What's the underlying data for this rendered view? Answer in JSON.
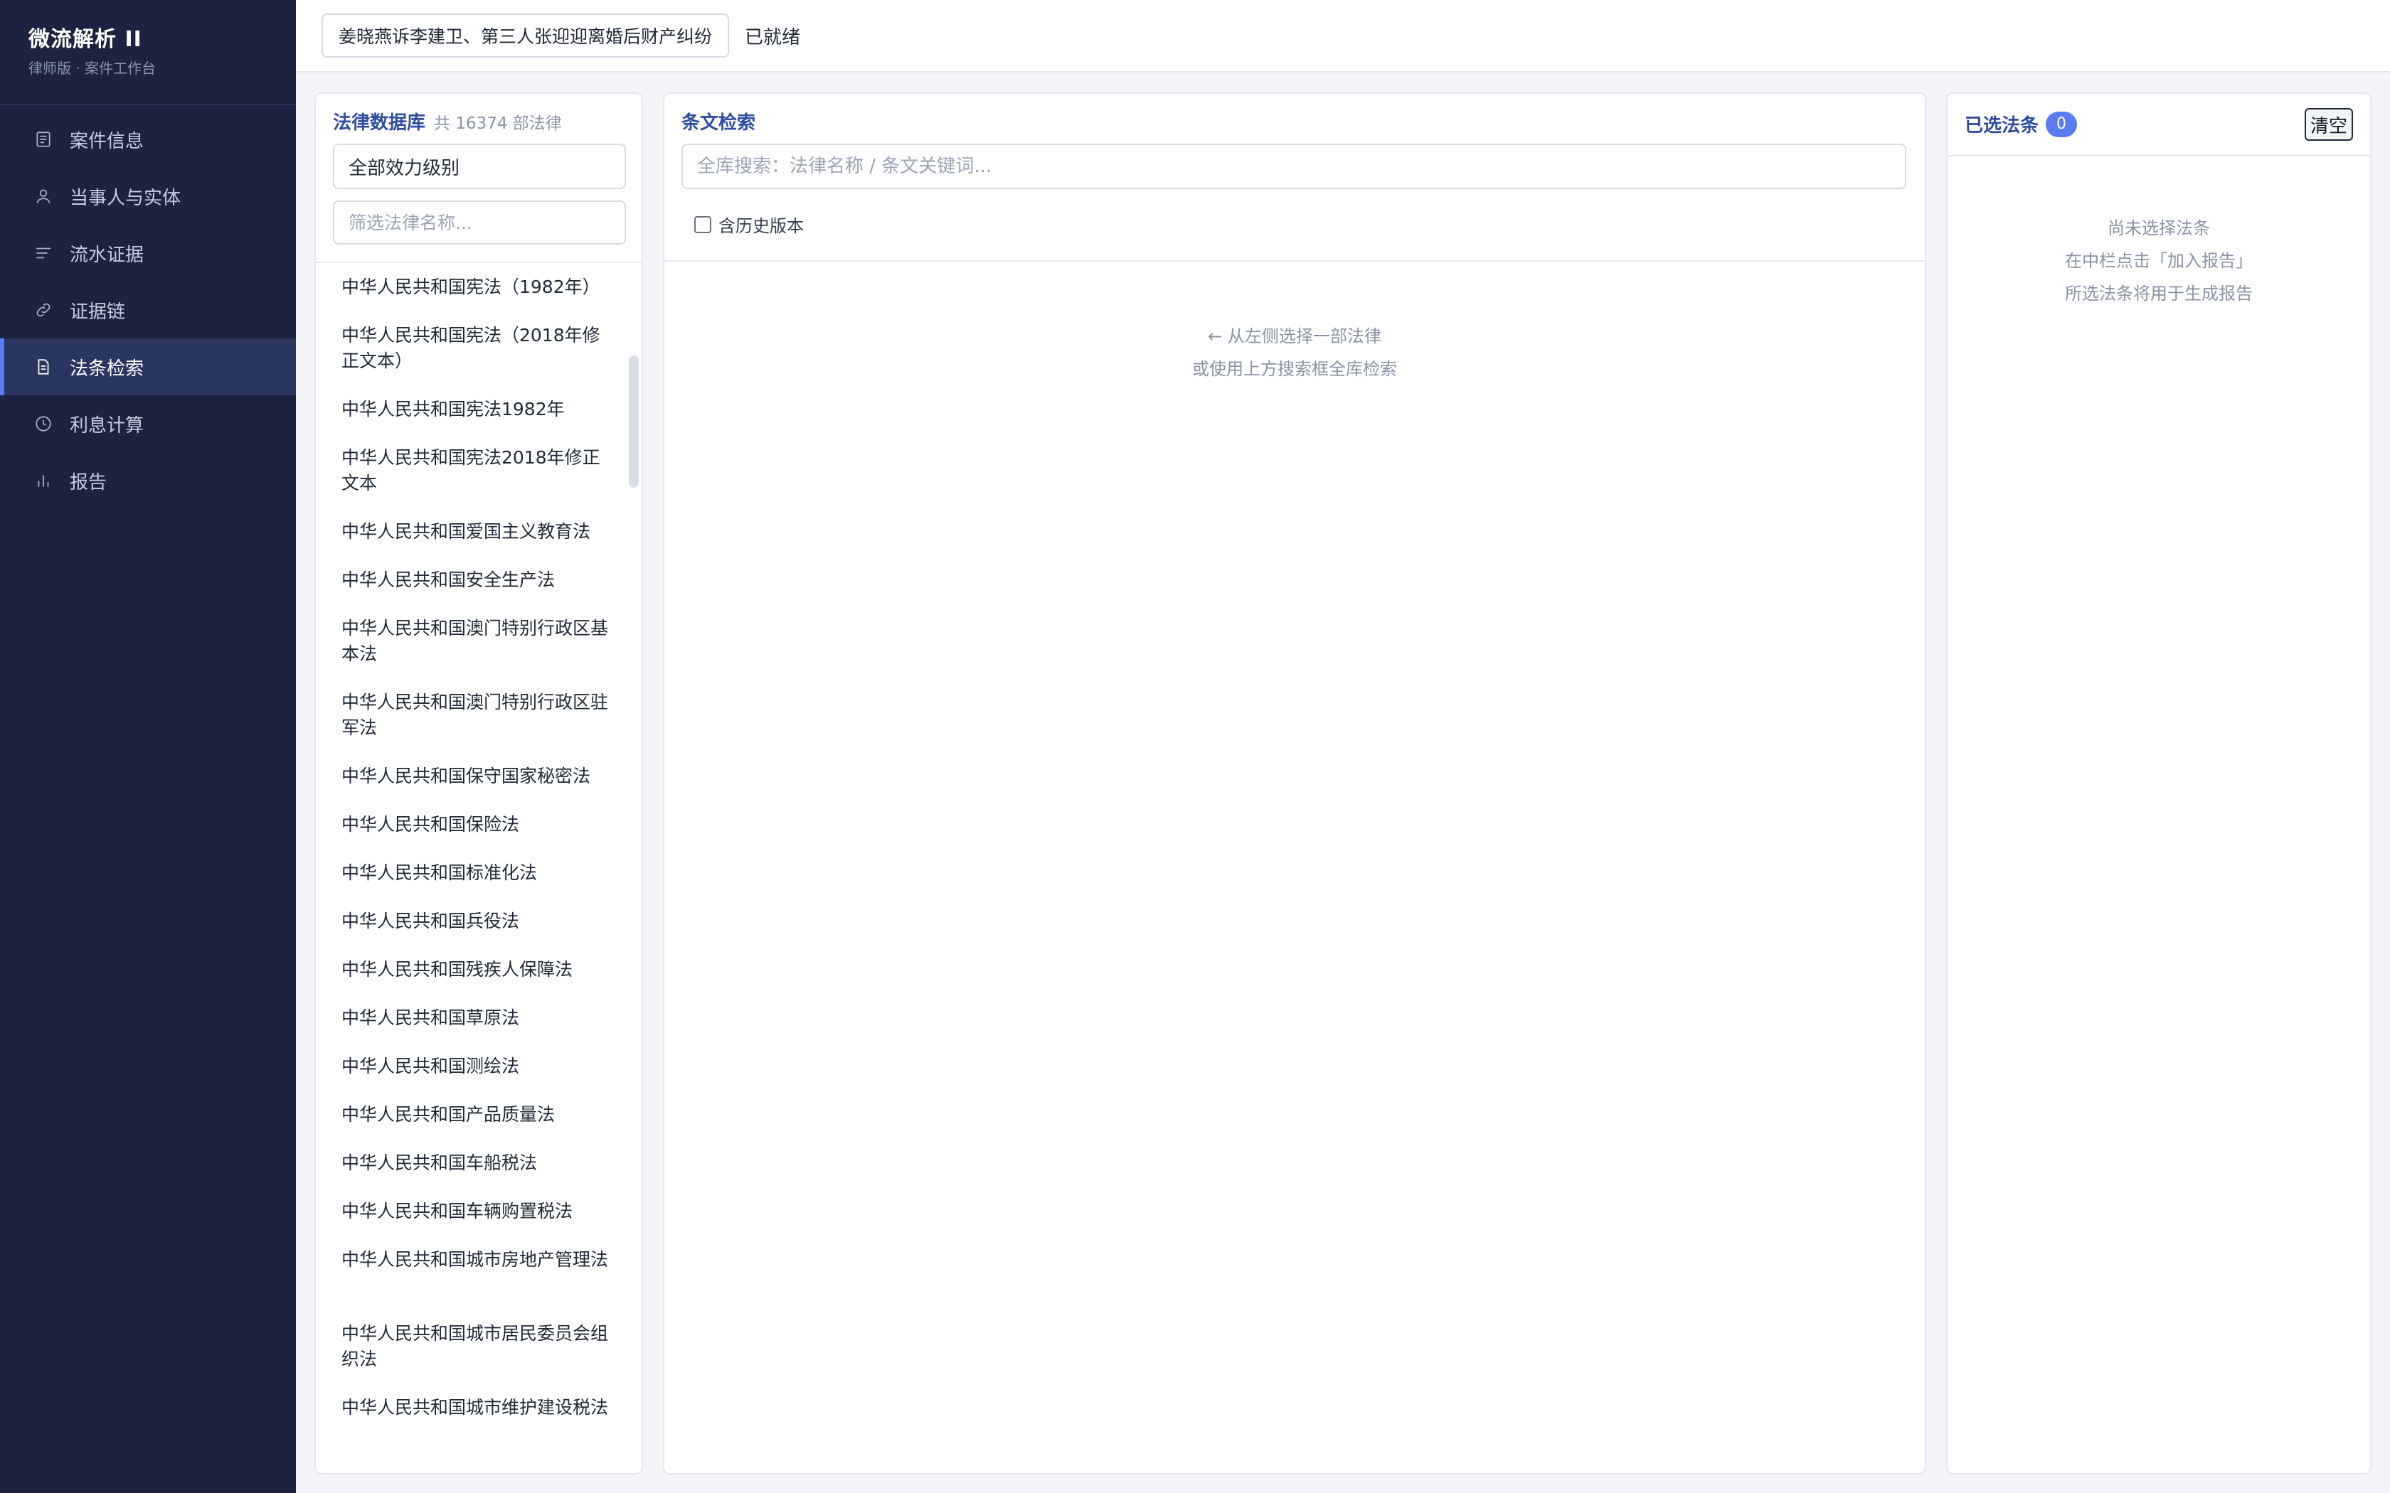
{
  "app": {
    "title": "微流解析 II",
    "subtitle": "律师版 · 案件工作台"
  },
  "sidebar": {
    "items": [
      {
        "label": "案件信息",
        "icon": "document-icon",
        "active": false
      },
      {
        "label": "当事人与实体",
        "icon": "user-icon",
        "active": false
      },
      {
        "label": "流水证据",
        "icon": "list-icon",
        "active": false
      },
      {
        "label": "证据链",
        "icon": "link-icon",
        "active": false
      },
      {
        "label": "法条检索",
        "icon": "file-text-icon",
        "active": true
      },
      {
        "label": "利息计算",
        "icon": "clock-icon",
        "active": false
      },
      {
        "label": "报告",
        "icon": "bar-chart-icon",
        "active": false
      }
    ]
  },
  "topbar": {
    "case_name": "姜晓燕诉李建卫、第三人张迎迎离婚后财产纠纷",
    "status": "已就绪"
  },
  "law_db": {
    "title": "法律数据库",
    "count_text": "共 16374 部法律",
    "level_select": "全部效力级别",
    "filter_placeholder": "筛选法律名称...",
    "laws": [
      "中华人民共和国宪法（1982年）",
      "中华人民共和国宪法（2018年修正文本）",
      "中华人民共和国宪法1982年",
      "中华人民共和国宪法2018年修正文本",
      "中华人民共和国爱国主义教育法",
      "中华人民共和国安全生产法",
      "中华人民共和国澳门特别行政区基本法",
      "中华人民共和国澳门特别行政区驻军法",
      "中华人民共和国保守国家秘密法",
      "中华人民共和国保险法",
      "中华人民共和国标准化法",
      "中华人民共和国兵役法",
      "中华人民共和国残疾人保障法",
      "中华人民共和国草原法",
      "中华人民共和国测绘法",
      "中华人民共和国产品质量法",
      "中华人民共和国车船税法",
      "中华人民共和国车辆购置税法",
      "中华人民共和国城市房地产管理法",
      "中华人民共和国城市居民委员会组织法",
      "中华人民共和国城市维护建设税法"
    ]
  },
  "article_search": {
    "title": "条文检索",
    "search_placeholder": "全库搜索：法律名称 / 条文关键词...",
    "history_label": "含历史版本",
    "empty_line1": "← 从左侧选择一部法律",
    "empty_line2": "或使用上方搜索框全库检索"
  },
  "selected": {
    "title": "已选法条",
    "count": "0",
    "clear_label": "清空",
    "empty_line1": "尚未选择法条",
    "empty_line2": "在中栏点击「加入报告」",
    "empty_line3": "所选法条将用于生成报告"
  },
  "colors": {
    "sidebar_bg": "#1b2340",
    "accent": "#5b7cf0",
    "panel_title": "#2f4ea1"
  }
}
